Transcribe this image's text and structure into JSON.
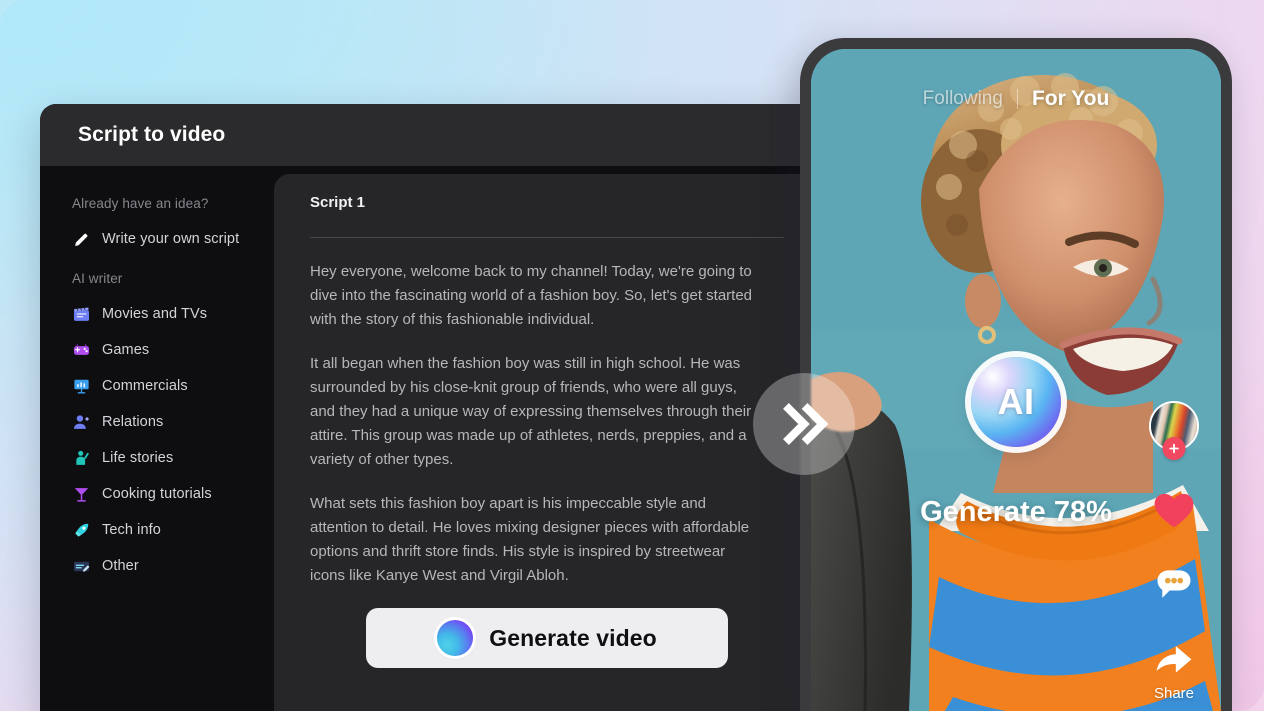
{
  "theme": {
    "bg_start": "#b9e9f7",
    "bg_end": "#f3d3ec",
    "panel_dark": "#0e0e11",
    "panel_mid": "#262629",
    "header_bar": "#2b2b2e",
    "accent_heart": "#f2415c",
    "accent_plus": "#f1485f",
    "button_light": "#eeeef0"
  },
  "app": {
    "title": "Script to video"
  },
  "sidebar": {
    "idea_label": "Already have an idea?",
    "write_own": {
      "label": "Write your own script",
      "icon": "pencil-icon"
    },
    "ai_writer_label": "AI writer",
    "items": [
      {
        "label": "Movies and TVs",
        "icon": "clapperboard-icon"
      },
      {
        "label": "Games",
        "icon": "game-controller-icon"
      },
      {
        "label": "Commercials",
        "icon": "presentation-chart-icon"
      },
      {
        "label": "Relations",
        "icon": "person-icon"
      },
      {
        "label": "Life stories",
        "icon": "person-waving-icon"
      },
      {
        "label": "Cooking tutorials",
        "icon": "cocktail-glass-icon"
      },
      {
        "label": "Tech info",
        "icon": "rocket-icon"
      },
      {
        "label": "Other",
        "icon": "document-pencil-icon"
      }
    ]
  },
  "script": {
    "title": "Script 1",
    "paragraphs": [
      "Hey everyone, welcome back to my channel! Today, we're going to dive into the fascinating world of a fashion boy. So, let's get started with the story of this fashionable individual.",
      "It all began when the fashion boy was still in high school. He was surrounded by his close-knit group of friends, who were all guys, and they had a unique way of expressing themselves through their attire. This group was made up of athletes, nerds, preppies, and a variety of other types.",
      "What sets this fashion boy apart is his impeccable style and attention to detail. He loves mixing designer pieces with affordable options and thrift store finds. His style is inspired by streetwear icons like Kanye West and Virgil Abloh."
    ],
    "generate_button": {
      "label": "Generate video",
      "icon": "ai-orb-icon"
    }
  },
  "forward_button": {
    "icon": "double-chevron-right-icon"
  },
  "phone": {
    "tabs": {
      "following": "Following",
      "for_you": "For You",
      "active": "For You"
    },
    "ai_badge": {
      "label": "AI"
    },
    "progress": {
      "text": "Generate 78%",
      "percent": 78
    },
    "rail": {
      "avatar": {
        "icon": "avatar",
        "plus_icon": "plus-icon"
      },
      "like": {
        "icon": "heart-icon",
        "label": ""
      },
      "comment": {
        "icon": "comment-bubble-icon",
        "label": ""
      },
      "share": {
        "icon": "share-arrow-icon",
        "label": "Share"
      }
    }
  }
}
